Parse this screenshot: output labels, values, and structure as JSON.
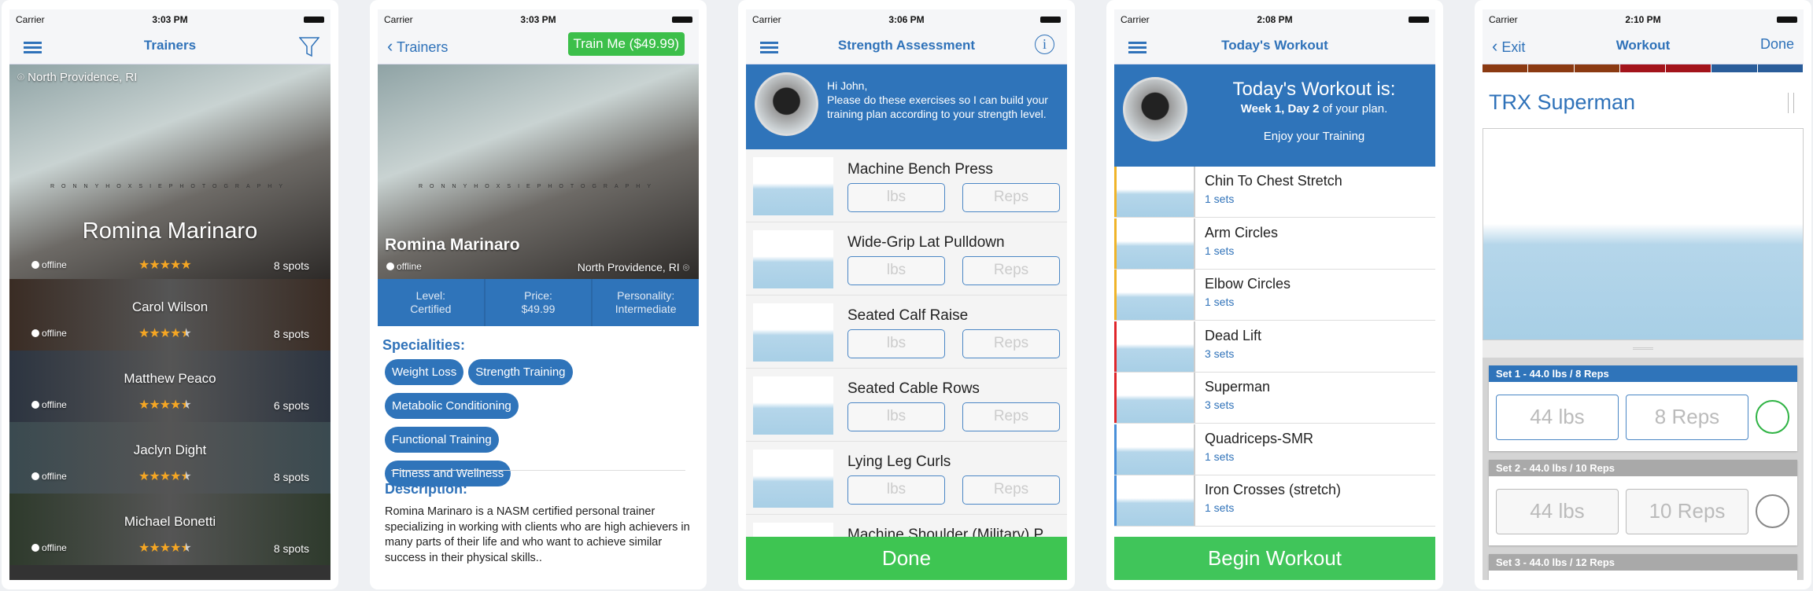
{
  "colors": {
    "nav_blue": "#2f72b9",
    "banner_blue": "#2f74ba",
    "green": "#3ec552",
    "star": "#f5a623"
  },
  "trainers_screen": {
    "status": {
      "carrier": "Carrier",
      "time": "3:03 PM"
    },
    "title": "Trainers",
    "menu_icon": "hamburger-icon",
    "filter_icon": "filter-icon",
    "location": "North Providence, RI",
    "featured": {
      "name": "Romina Marinaro",
      "status": "offline",
      "rating": 5,
      "spots": "8 spots",
      "watermark": "RONNYHOXSIEPHOTOGRAPHY"
    },
    "list": [
      {
        "name": "Carol Wilson",
        "status": "offline",
        "rating": 4.5,
        "spots": "8 spots"
      },
      {
        "name": "Matthew Peaco",
        "status": "offline",
        "rating": 4.5,
        "spots": "6 spots"
      },
      {
        "name": "Jaclyn Dight",
        "status": "offline",
        "rating": 4.5,
        "spots": "8 spots"
      },
      {
        "name": "Michael Bonetti",
        "status": "offline",
        "rating": 4.5,
        "spots": "8 spots"
      }
    ]
  },
  "profile_screen": {
    "status": {
      "carrier": "Carrier",
      "time": "3:03 PM"
    },
    "back_label": "Trainers",
    "train_button": "Train Me ($49.99)",
    "name": "Romina Marinaro",
    "status_text": "offline",
    "location": "North Providence, RI",
    "stats": [
      {
        "label": "Level:",
        "value": "Certified"
      },
      {
        "label": "Price:",
        "value": "$49.99"
      },
      {
        "label": "Personality:",
        "value": "Intermediate"
      }
    ],
    "specialities_heading": "Specialities:",
    "specialities": [
      "Weight Loss",
      "Strength Training",
      "Metabolic Conditioning",
      "Functional Training",
      "Fitness and Wellness"
    ],
    "description_heading": "Description:",
    "description": "Romina Marinaro is a NASM certified personal trainer specializing in working with clients who are high achievers in many parts of their life and who want to achieve similar success in their physical skills.."
  },
  "assessment_screen": {
    "status": {
      "carrier": "Carrier",
      "time": "3:06 PM"
    },
    "title": "Strength Assessment",
    "info_icon": "info-icon",
    "greeting": "Hi John,",
    "message": "Please do these exercises so I can build your training plan according to your strength level.",
    "lbs_placeholder": "lbs",
    "reps_placeholder": "Reps",
    "exercises": [
      "Machine Bench Press",
      "Wide-Grip Lat Pulldown",
      "Seated Calf Raise",
      "Seated Cable Rows",
      "Lying Leg Curls",
      "Machine Shoulder (Military) P..."
    ],
    "done_button": "Done"
  },
  "workout_screen": {
    "status": {
      "carrier": "Carrier",
      "time": "2:08 PM"
    },
    "title": "Today's Workout",
    "banner_title": "Today's Workout is:",
    "banner_plan_bold": "Week 1, Day 2",
    "banner_plan_rest": " of your plan.",
    "banner_sub": "Enjoy your Training",
    "exercises": [
      {
        "name": "Chin To Chest Stretch",
        "sets": "1 sets",
        "color": "#f0b429"
      },
      {
        "name": "Arm Circles",
        "sets": "1 sets",
        "color": "#f0b429"
      },
      {
        "name": "Elbow Circles",
        "sets": "1 sets",
        "color": "#f0b429"
      },
      {
        "name": "Dead Lift",
        "sets": "3 sets",
        "color": "#e0262b"
      },
      {
        "name": "Superman",
        "sets": "3 sets",
        "color": "#e0262b"
      },
      {
        "name": "Quadriceps-SMR",
        "sets": "1 sets",
        "color": "#4a90d9"
      },
      {
        "name": "Iron Crosses (stretch)",
        "sets": "1 sets",
        "color": "#4a90d9"
      }
    ],
    "begin_button": "Begin Workout"
  },
  "session_screen": {
    "status": {
      "carrier": "Carrier",
      "time": "2:10 PM"
    },
    "exit_label": "Exit",
    "title": "Workout",
    "done_label": "Done",
    "progress_segments": [
      "#8b3a12",
      "#8b3a12",
      "#8b3a12",
      "#a3141b",
      "#a3141b",
      "#2a5d9a",
      "#2a5d9a"
    ],
    "exercise_name": "TRX Superman",
    "sets": [
      {
        "header": "Set 1 - 44.0 lbs / 8 Reps",
        "lbs": "44 lbs",
        "reps": "8 Reps",
        "active": true
      },
      {
        "header": "Set 2 - 44.0 lbs / 10 Reps",
        "lbs": "44 lbs",
        "reps": "10 Reps",
        "active": false
      },
      {
        "header": "Set 3 - 44.0 lbs / 12 Reps",
        "lbs": "",
        "reps": "",
        "active": false
      }
    ]
  }
}
